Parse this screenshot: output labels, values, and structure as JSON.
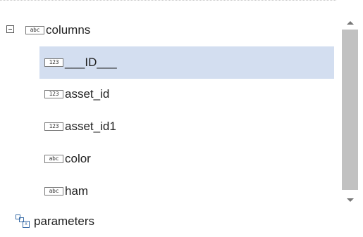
{
  "tree": {
    "root": {
      "label": "columns",
      "type_icon": "abc",
      "expanded": true
    },
    "children": [
      {
        "label": "___ID___",
        "type_icon": "123",
        "selected": true
      },
      {
        "label": "asset_id",
        "type_icon": "123"
      },
      {
        "label": "asset_id1",
        "type_icon": "123"
      },
      {
        "label": "color",
        "type_icon": "abc"
      },
      {
        "label": "ham",
        "type_icon": "abc"
      }
    ],
    "sibling": {
      "label": "parameters",
      "icon": "parameters-icon"
    }
  },
  "colors": {
    "selection": "#d3def0",
    "scroll_thumb": "#c1c1c1"
  }
}
